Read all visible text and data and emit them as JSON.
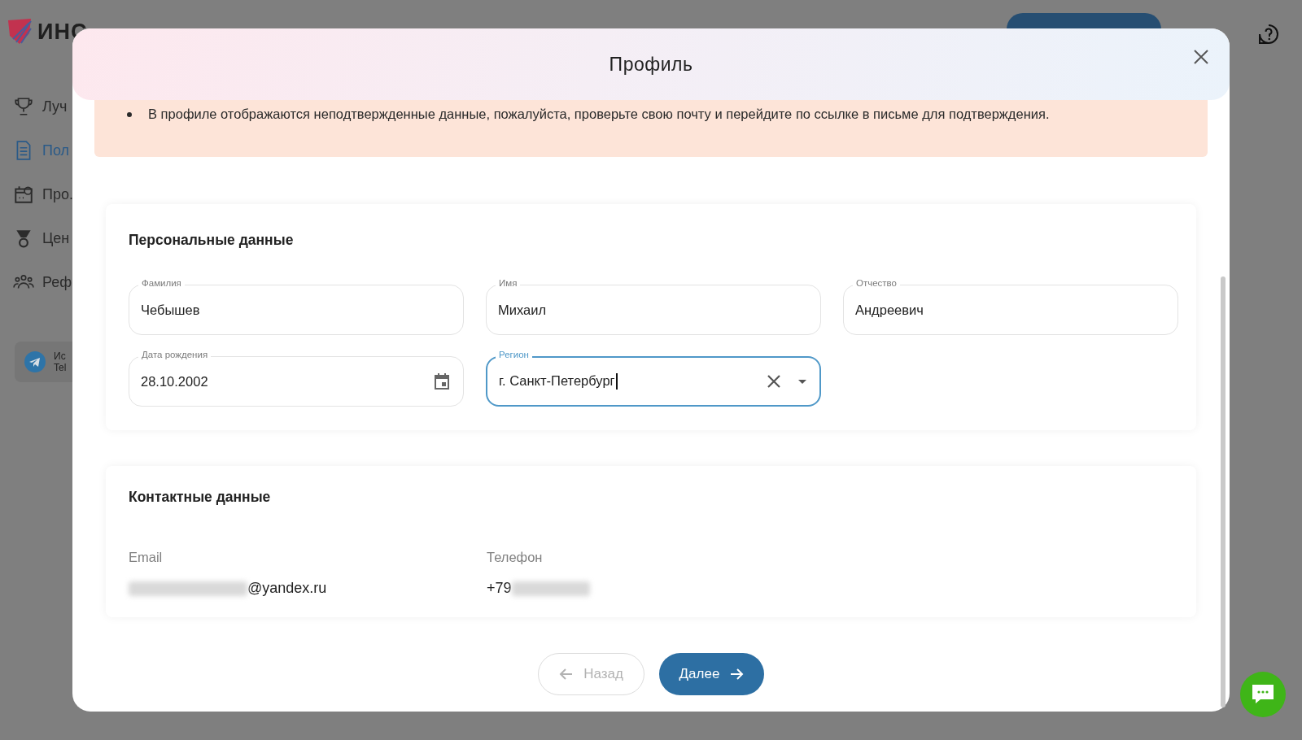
{
  "background": {
    "logo": "ИНС",
    "sidebar": [
      {
        "label": "Луч",
        "selected": false
      },
      {
        "label": "Пол",
        "selected": true
      },
      {
        "label": "Про.",
        "selected": false
      },
      {
        "label": "Цен",
        "selected": false
      },
      {
        "label": "Реф",
        "selected": false
      }
    ],
    "telegram": {
      "line_1": "Ис",
      "line_2": "Tel"
    }
  },
  "modal": {
    "title": "Профиль",
    "alert": [
      "В профиле отображаются неподтвержденные данные, пожалуйста, проверьте свою почту и перейдите по ссылке в письме для подтверждения."
    ],
    "personal": {
      "title": "Персональные данные",
      "fields": [
        {
          "label": "Фамилия",
          "value": "Чебышев",
          "kind": "text",
          "focused": false
        },
        {
          "label": "Имя",
          "value": "Михаил",
          "kind": "text",
          "focused": false
        },
        {
          "label": "Отчество",
          "value": "Андреевич",
          "kind": "text",
          "focused": false
        },
        {
          "label": "Дата рождения",
          "value": "28.10.2002",
          "kind": "date",
          "focused": false
        },
        {
          "label": "Регион",
          "value": "г. Санкт-Петербург",
          "kind": "select",
          "focused": true
        }
      ]
    },
    "contacts": {
      "title": "Контактные данные",
      "items": [
        {
          "label": "Email",
          "value": "@yandex.ru"
        },
        {
          "label": "Телефон",
          "value": "+79"
        }
      ]
    },
    "buttons": [
      {
        "label": "Назад",
        "kind": "back",
        "disabled": true
      },
      {
        "label": "Далее",
        "kind": "next",
        "disabled": false
      }
    ]
  }
}
